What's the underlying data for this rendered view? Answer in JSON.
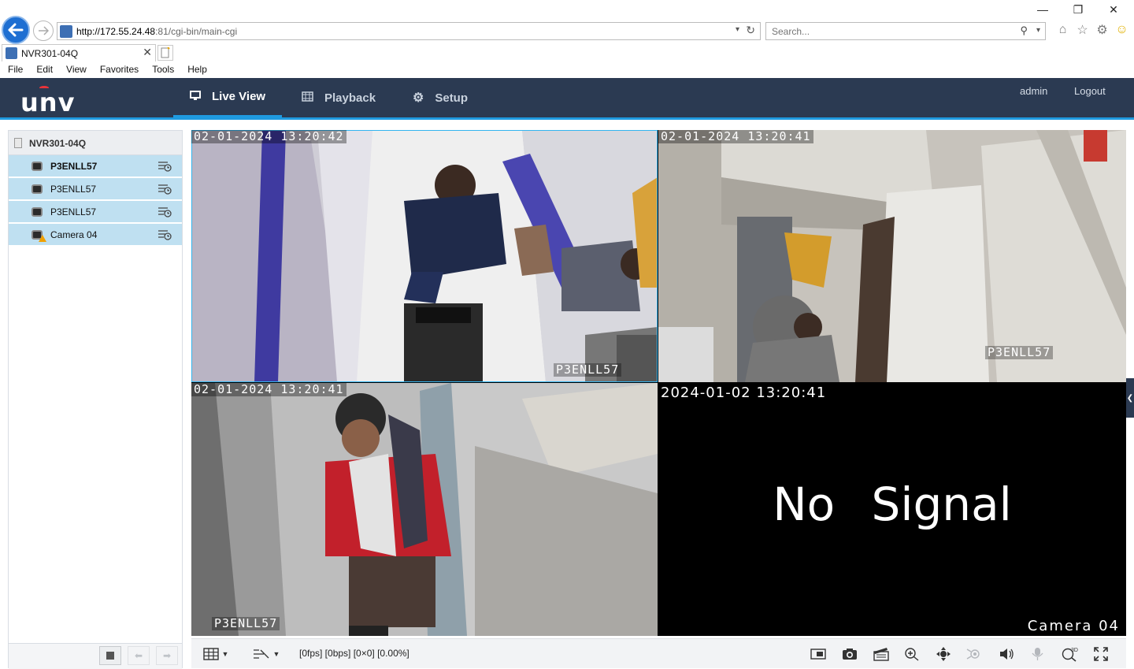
{
  "browser": {
    "url_host": "http://172.55.24.48",
    "url_path": ":81/cgi-bin/main-cgi",
    "search_placeholder": "Search...",
    "tab_title": "NVR301-04Q",
    "menu": [
      "File",
      "Edit",
      "View",
      "Favorites",
      "Tools",
      "Help"
    ]
  },
  "header": {
    "logo": "unv",
    "nav": [
      {
        "label": "Live View",
        "icon": "monitor-icon",
        "active": true
      },
      {
        "label": "Playback",
        "icon": "film-icon",
        "active": false
      },
      {
        "label": "Setup",
        "icon": "gear-icon",
        "active": false
      }
    ],
    "user": "admin",
    "logout": "Logout"
  },
  "sidebar": {
    "device": "NVR301-04Q",
    "cameras": [
      {
        "label": "P3ENLL57",
        "bold": true,
        "warning": false
      },
      {
        "label": "P3ENLL57",
        "bold": false,
        "warning": false
      },
      {
        "label": "P3ENLL57",
        "bold": false,
        "warning": false
      },
      {
        "label": "Camera 04",
        "bold": false,
        "warning": true
      }
    ]
  },
  "panes": [
    {
      "timestamp": "02-01-2024 13:20:42",
      "label": "P3ENLL57"
    },
    {
      "timestamp": "02-01-2024 13:20:41",
      "label": "P3ENLL57"
    },
    {
      "timestamp": "02-01-2024 13:20:41",
      "label": "P3ENLL57"
    },
    {
      "timestamp": "2024-01-02 13:20:41",
      "label": "Camera 04",
      "no_signal_text": "No Signal"
    }
  ],
  "toolbar": {
    "status": "[0fps] [0bps] [0×0] [0.00%]"
  },
  "colors": {
    "header_bg": "#2b3a52",
    "accent": "#1f9ae0",
    "camera_row_bg": "#bfe0f1"
  }
}
